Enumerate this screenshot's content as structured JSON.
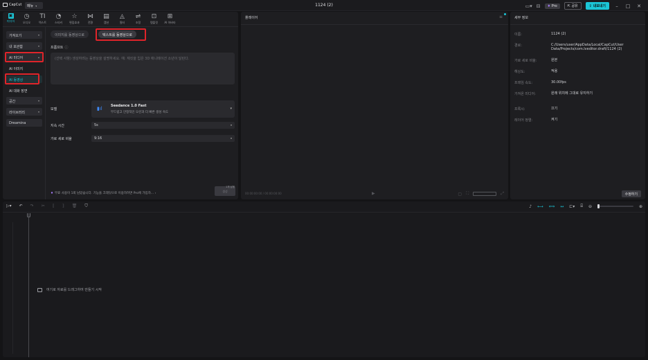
{
  "app": {
    "logo_text": "CapCut",
    "menu_label": "메뉴",
    "doc_title": "1124 (2)"
  },
  "titlebar": {
    "pro_label": "Pro",
    "share_label": "공유",
    "export_label": "내보내기"
  },
  "toolbar": [
    {
      "label": "미디어",
      "icon": "media-icon",
      "glyph": "▣",
      "active": true
    },
    {
      "label": "오디오",
      "icon": "audio-icon",
      "glyph": "◷"
    },
    {
      "label": "텍스트",
      "icon": "text-icon",
      "glyph": "TI"
    },
    {
      "label": "스티커",
      "icon": "sticker-icon",
      "glyph": "◔"
    },
    {
      "label": "편집효과",
      "icon": "effects-icon",
      "glyph": "☆"
    },
    {
      "label": "전환",
      "icon": "transition-icon",
      "glyph": "⋈"
    },
    {
      "label": "캡션",
      "icon": "caption-icon",
      "glyph": "▤"
    },
    {
      "label": "필터",
      "icon": "filter-icon",
      "glyph": "◬"
    },
    {
      "label": "조정",
      "icon": "adjust-icon",
      "glyph": "⇌"
    },
    {
      "label": "템플릿",
      "icon": "template-icon",
      "glyph": "⊡"
    },
    {
      "label": "AI 아바타",
      "icon": "ai-avatar-icon",
      "glyph": "⊞"
    }
  ],
  "sidebar": {
    "import": "가져오기",
    "my_assets": "내 보관함",
    "ai_media": "AI 미디어",
    "ai_image": "AI 이미지",
    "ai_video": "AI 동영상",
    "ai_long": "AI 대화 장면",
    "space": "공간",
    "library": "라이브러리",
    "dreamina": "Dreamina"
  },
  "ai_video": {
    "tab_image": "이미지를 동영상으로",
    "tab_text": "텍스트를 동영상으로",
    "prompt_label": "프롬프트",
    "prompt_help": "ⓘ",
    "prompt_placeholder": "(선택 사항) 생성하려는 동영상을 설명하세요. 예: 재킷을 입은 3D 애니메이션 소년이 달린다.",
    "model_label": "모델",
    "model_name": "Seedance 1.0 Fast",
    "model_desc": "부드럽고 안정적인 모션과 더 빠른 생성 속도",
    "duration_label": "지속 시간",
    "duration_value": "5s",
    "ratio_label": "가로 세로 비율",
    "ratio_value": "9:16",
    "free_note": "무료 사용이 1회 남았습니다. 기능을 크레딧으로 이용하려면 Pro에 가입하...",
    "gen_count": "1개 남음",
    "gen_label": "생성"
  },
  "player": {
    "title": "플레이어",
    "timecode": "00:00:00:00 / 00:00:00:00"
  },
  "details": {
    "title": "세부 정보",
    "rows": [
      {
        "k": "이름:",
        "v": "1124 (2)"
      },
      {
        "k": "경로:",
        "v": "C:/Users/user/AppData/Local/CapCut/User Data/Projects/com.lveditor.draft/1124 (2)"
      },
      {
        "k": "가로 세로 비율:",
        "v": "원본"
      },
      {
        "k": "해상도:",
        "v": "적용"
      },
      {
        "k": "프레임 속도:",
        "v": "30.00fps"
      },
      {
        "k": "가져온 미디어:",
        "v": "원래 위치에 그대로 유지하기"
      },
      {
        "k": "프록시:",
        "v": "끄기"
      },
      {
        "k": "레이어 정렬:",
        "v": "켜기"
      }
    ],
    "edit_label": "수정하기"
  },
  "timeline": {
    "drop_hint": "여기로 자료를 드래그하여 만들기 시작"
  }
}
